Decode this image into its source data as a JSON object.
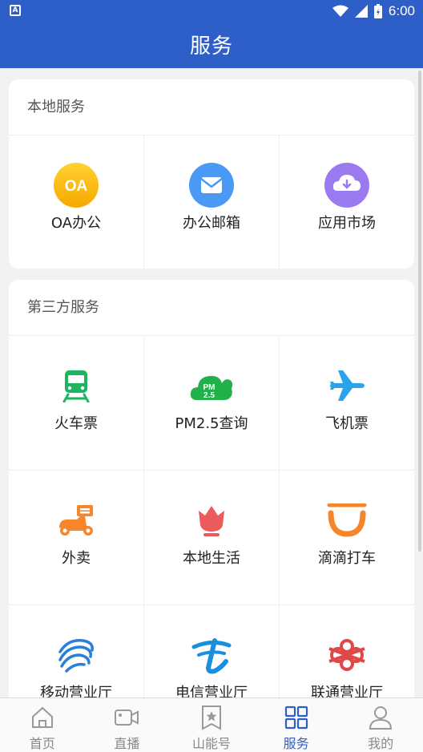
{
  "status_bar": {
    "time": "6:00",
    "notification_glyph": "A"
  },
  "header": {
    "title": "服务"
  },
  "local_services": {
    "title": "本地服务",
    "items": [
      {
        "label": "OA办公",
        "icon": "oa-icon",
        "icon_text": "OA"
      },
      {
        "label": "办公邮箱",
        "icon": "mail-icon"
      },
      {
        "label": "应用市场",
        "icon": "cloud-download-icon"
      }
    ]
  },
  "third_party": {
    "title": "第三方服务",
    "items": [
      {
        "label": "火车票",
        "icon": "train-icon"
      },
      {
        "label": "PM2.5查询",
        "icon": "pm25-cloud-icon",
        "icon_text": "PM 2.5"
      },
      {
        "label": "飞机票",
        "icon": "airplane-icon"
      },
      {
        "label": "外卖",
        "icon": "scooter-icon"
      },
      {
        "label": "本地生活",
        "icon": "tulip-icon"
      },
      {
        "label": "滴滴打车",
        "icon": "didi-icon"
      },
      {
        "label": "移动营业厅",
        "icon": "china-mobile-icon"
      },
      {
        "label": "电信营业厅",
        "icon": "china-telecom-icon"
      },
      {
        "label": "联通营业厅",
        "icon": "china-unicom-icon"
      }
    ]
  },
  "tabs": [
    {
      "label": "首页",
      "icon": "home-icon"
    },
    {
      "label": "直播",
      "icon": "video-camera-icon"
    },
    {
      "label": "山能号",
      "icon": "bookmark-star-icon"
    },
    {
      "label": "服务",
      "icon": "grid-icon",
      "active": true
    },
    {
      "label": "我的",
      "icon": "user-icon"
    }
  ],
  "colors": {
    "primary": "#2e5fc9",
    "oa": "#f7b500",
    "mail": "#4a9af5",
    "market": "#9b7af0",
    "train": "#1db561",
    "pm25": "#22b04b",
    "plane": "#2ba3e8",
    "takeaway": "#f7862a",
    "tulip": "#ec5a5a",
    "didi": "#f7862a",
    "mobile": "#2a7fd9",
    "telecom": "#1a8fe0",
    "unicom": "#e04848"
  }
}
